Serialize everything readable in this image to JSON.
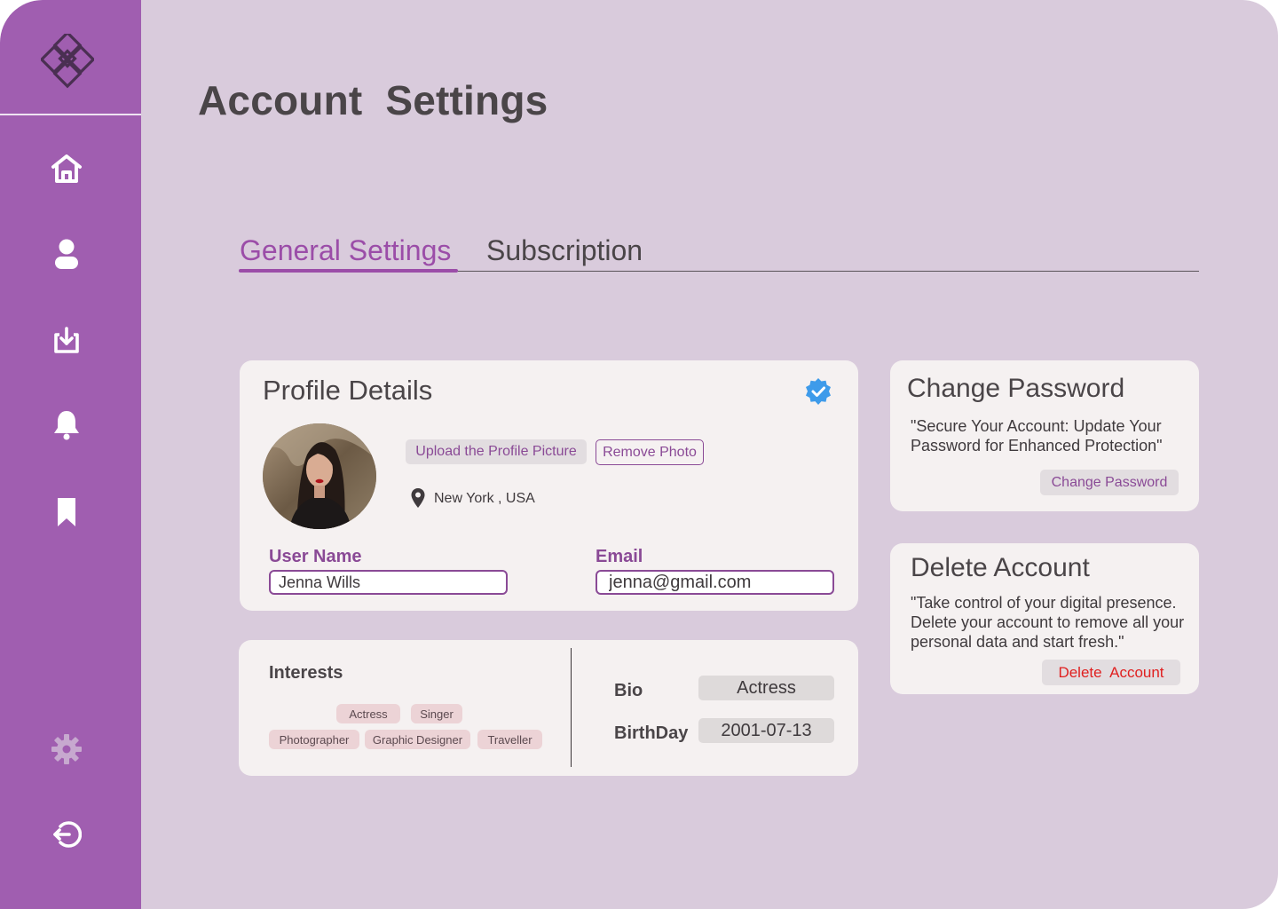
{
  "page": {
    "title": "Account  Settings"
  },
  "sidebar": {
    "logo": "brand-logo",
    "items": [
      {
        "icon": "home-icon"
      },
      {
        "icon": "user-icon"
      },
      {
        "icon": "download-icon"
      },
      {
        "icon": "bell-icon"
      },
      {
        "icon": "bookmark-icon"
      },
      {
        "icon": "gear-icon"
      },
      {
        "icon": "logout-icon"
      }
    ]
  },
  "tabs": [
    {
      "label": "General Settings",
      "active": true
    },
    {
      "label": "Subscription",
      "active": false
    }
  ],
  "profile": {
    "title": "Profile Details",
    "verified_icon": "verified-badge-icon",
    "upload_label": "Upload the Profile Picture",
    "remove_label": "Remove Photo",
    "location": "New York , USA",
    "username_label": "User Name",
    "username_value": "Jenna Wills",
    "email_label": "Email",
    "email_value": "jenna@gmail.com"
  },
  "interests": {
    "title": "Interests",
    "chips": [
      "Actress",
      "Singer",
      "Photographer",
      "Graphic Designer",
      "Traveller"
    ]
  },
  "about": {
    "bio_label": "Bio",
    "bio_value": "Actress",
    "birthday_label": "BirthDay",
    "birthday_value": "2001-07-13"
  },
  "password": {
    "title": "Change Password",
    "text": "\"Secure Your Account: Update Your Password for Enhanced Protection\"",
    "button": "Change Password"
  },
  "delete": {
    "title": "Delete Account",
    "text": "\"Take control of your digital presence. Delete your account to remove all your personal data and start fresh.\"",
    "button": "Delete  Account"
  },
  "colors": {
    "sidebar": "#a05eb0",
    "background": "#d9cbdc",
    "accent": "#9b4da8",
    "danger": "#e02020",
    "verified": "#3e9bea"
  }
}
